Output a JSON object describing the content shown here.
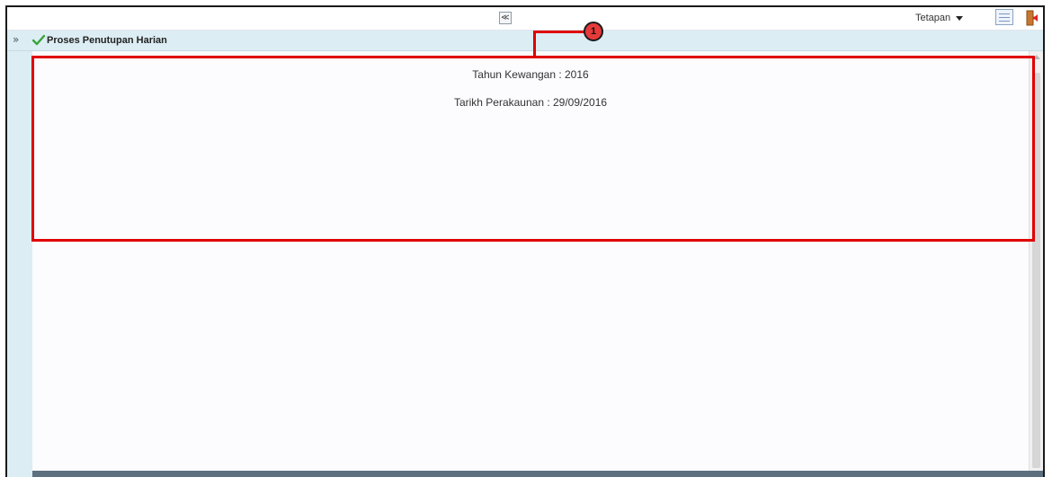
{
  "header": {
    "collapse_label": "≪",
    "settings_label": "Tetapan"
  },
  "toolbar": {
    "expand_label": "»",
    "title": "Proses Penutupan Harian"
  },
  "main": {
    "fiscal_year": "Tahun Kewangan : 2016",
    "accounting_date": "Tarikh Perakaunan : 29/09/2016"
  },
  "annotation": {
    "marker": "1",
    "color": "#e00000"
  },
  "icons": [
    "collapse-up-icon",
    "caret-down-icon",
    "list-view-icon",
    "logout-icon",
    "expand-icon",
    "check-icon"
  ]
}
